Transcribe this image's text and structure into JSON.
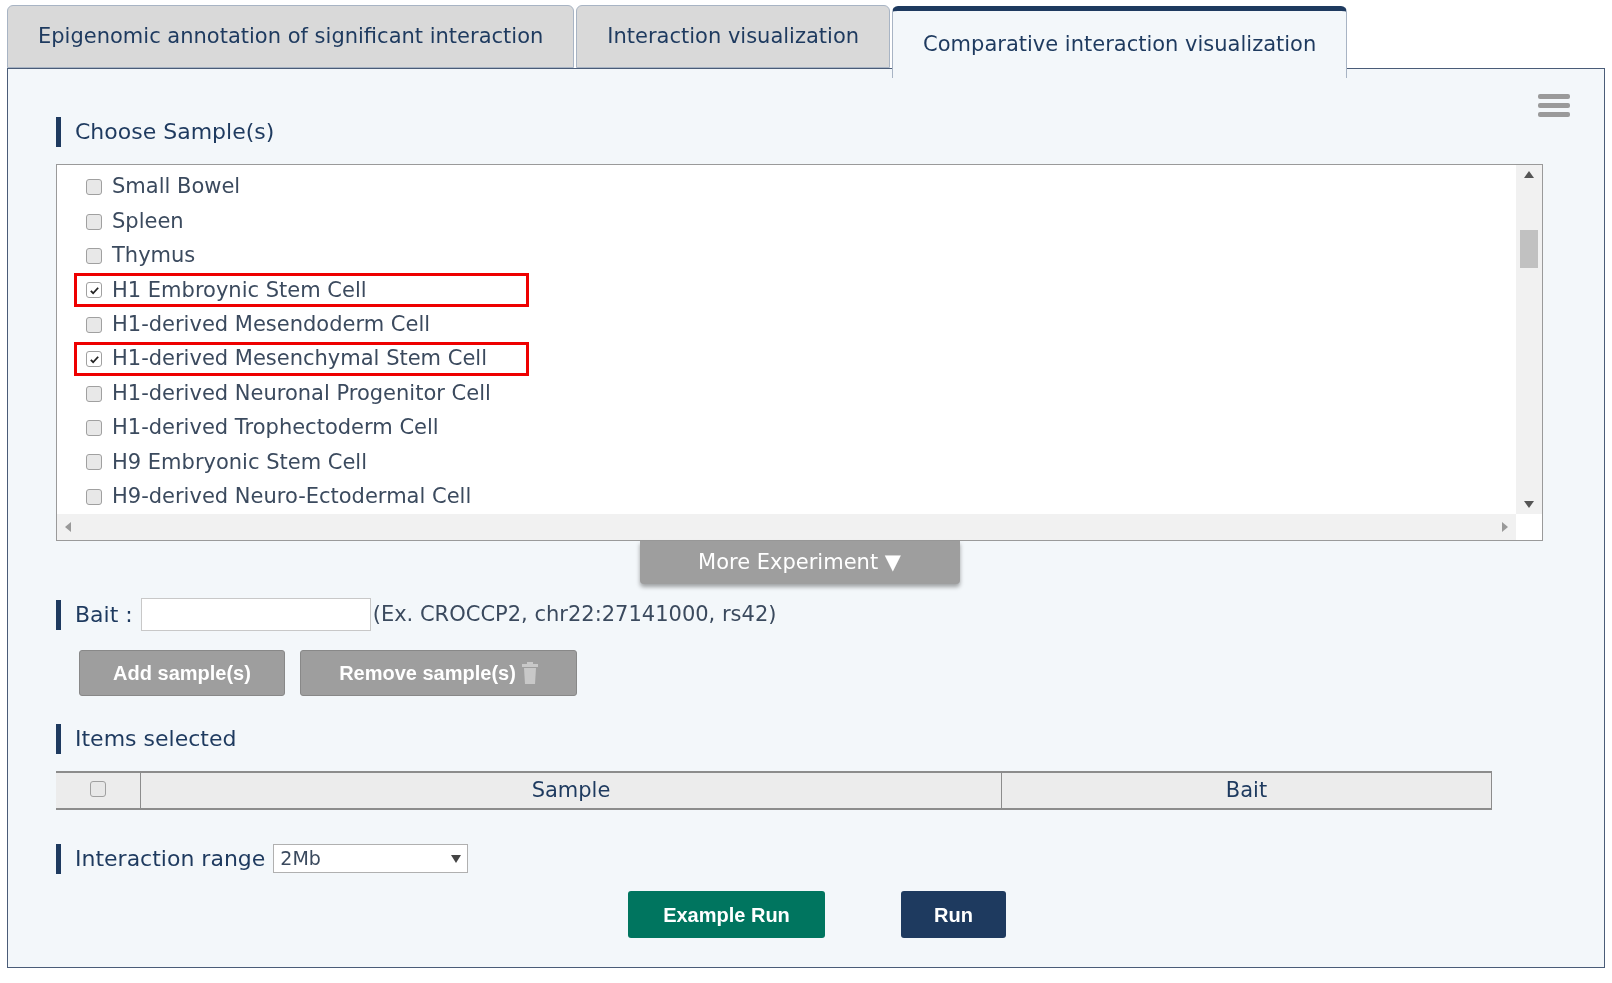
{
  "tabs": [
    {
      "label": "Epigenomic annotation of significant interaction",
      "selected": false
    },
    {
      "label": "Interaction visualization",
      "selected": false
    },
    {
      "label": "Comparative interaction visualization",
      "selected": true
    }
  ],
  "choose_samples": {
    "heading": "Choose Sample(s)",
    "items": [
      {
        "label": "Small Bowel",
        "checked": false,
        "highlighted": false
      },
      {
        "label": "Spleen",
        "checked": false,
        "highlighted": false
      },
      {
        "label": "Thymus",
        "checked": false,
        "highlighted": false
      },
      {
        "label": "H1 Embroynic Stem Cell",
        "checked": true,
        "highlighted": true
      },
      {
        "label": "H1-derived Mesendoderm Cell",
        "checked": false,
        "highlighted": false
      },
      {
        "label": "H1-derived Mesenchymal Stem Cell",
        "checked": true,
        "highlighted": true
      },
      {
        "label": "H1-derived Neuronal Progenitor Cell",
        "checked": false,
        "highlighted": false
      },
      {
        "label": "H1-derived Trophectoderm Cell",
        "checked": false,
        "highlighted": false
      },
      {
        "label": "H9 Embryonic Stem Cell",
        "checked": false,
        "highlighted": false
      },
      {
        "label": "H9-derived Neuro-Ectodermal Cell",
        "checked": false,
        "highlighted": false
      }
    ],
    "more_button": "More Experiment ▼"
  },
  "bait": {
    "label": "Bait :",
    "hint": "(Ex. CROCCP2, chr22:27141000, rs42)"
  },
  "buttons": {
    "add": "Add sample(s)",
    "remove": "Remove sample(s)"
  },
  "items_selected": {
    "heading": "Items selected",
    "select_all_checked": false,
    "columns": [
      "Sample",
      "Bait"
    ]
  },
  "interaction_range": {
    "label": "Interaction range",
    "value": "2Mb"
  },
  "actions": {
    "example_run": "Example Run",
    "run": "Run"
  }
}
